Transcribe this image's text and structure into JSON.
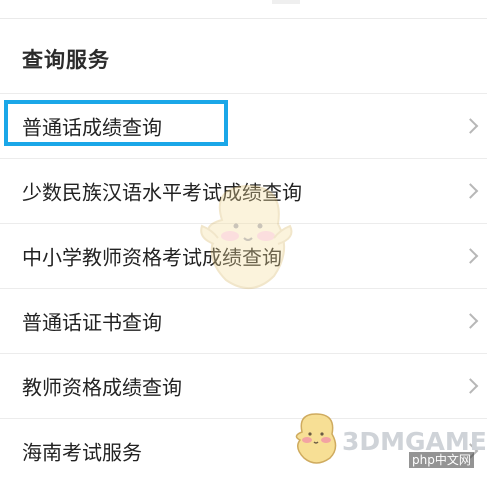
{
  "section": {
    "title": "查询服务"
  },
  "items": [
    {
      "label": "普通话成绩查询",
      "highlighted": true
    },
    {
      "label": "少数民族汉语水平考试成绩查询"
    },
    {
      "label": "中小学教师资格考试成绩查询"
    },
    {
      "label": "普通话证书查询"
    },
    {
      "label": "教师资格成绩查询"
    },
    {
      "label": "海南考试服务"
    }
  ],
  "icons": {
    "row_arrow": "chevron-right-icon"
  },
  "watermark": {
    "brand": "3DMGAME",
    "site": "php中文网"
  },
  "colors": {
    "highlight": "#1aa7e8",
    "chevron": "#b7b7b7",
    "divider": "#ececec"
  }
}
